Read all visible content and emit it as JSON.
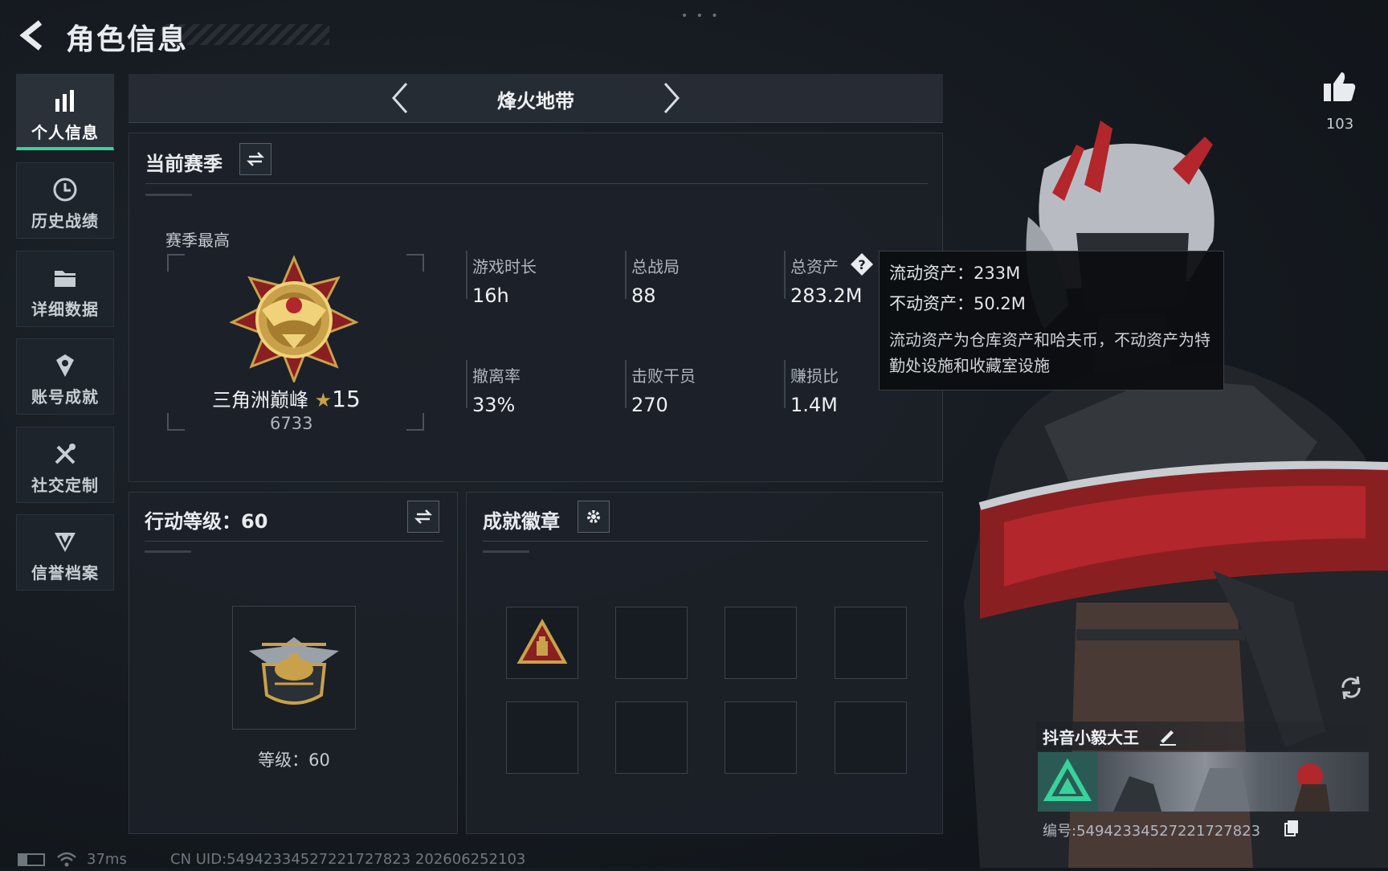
{
  "header": {
    "title": "角色信息"
  },
  "sidebar": {
    "items": [
      {
        "label": "个人信息",
        "icon": "bar-chart-icon",
        "active": true
      },
      {
        "label": "历史战绩",
        "icon": "clock-icon"
      },
      {
        "label": "详细数据",
        "icon": "folder-icon"
      },
      {
        "label": "账号成就",
        "icon": "achievement-icon"
      },
      {
        "label": "社交定制",
        "icon": "tools-icon"
      },
      {
        "label": "信誉档案",
        "icon": "credit-shield-icon"
      }
    ]
  },
  "mode_selector": {
    "title": "烽火地带"
  },
  "season": {
    "title": "当前赛季",
    "best_label": "赛季最高",
    "rank_name": "三角洲巅峰",
    "rank_stars": "15",
    "rank_score": "6733",
    "stats": [
      {
        "label": "游戏时长",
        "value": "16h"
      },
      {
        "label": "总战局",
        "value": "88"
      },
      {
        "label": "总资产",
        "value": "283.2M"
      },
      {
        "label": "撤离率",
        "value": "33%"
      },
      {
        "label": "击败干员",
        "value": "270"
      },
      {
        "label": "赚损比",
        "value": "1.4M"
      }
    ]
  },
  "tooltip": {
    "liquid": "流动资产：233M",
    "fixed": "不动资产：50.2M",
    "desc": "流动资产为仓库资产和哈夫币，不动资产为特勤处设施和收藏室设施"
  },
  "action_level": {
    "title": "行动等级：60",
    "level_text": "等级：60"
  },
  "badges": {
    "title": "成就徽章"
  },
  "likes": {
    "count": "103"
  },
  "profile": {
    "name": "抖音小毅大王",
    "uid": "编号:549423345272217278​23"
  },
  "status_bar": {
    "ping": "37ms",
    "cn_uid": "CN UID:549423345272217278​23 202606252103"
  },
  "colors": {
    "accent": "#37d39a",
    "gold": "#c9a14a",
    "red": "#b3262b"
  }
}
